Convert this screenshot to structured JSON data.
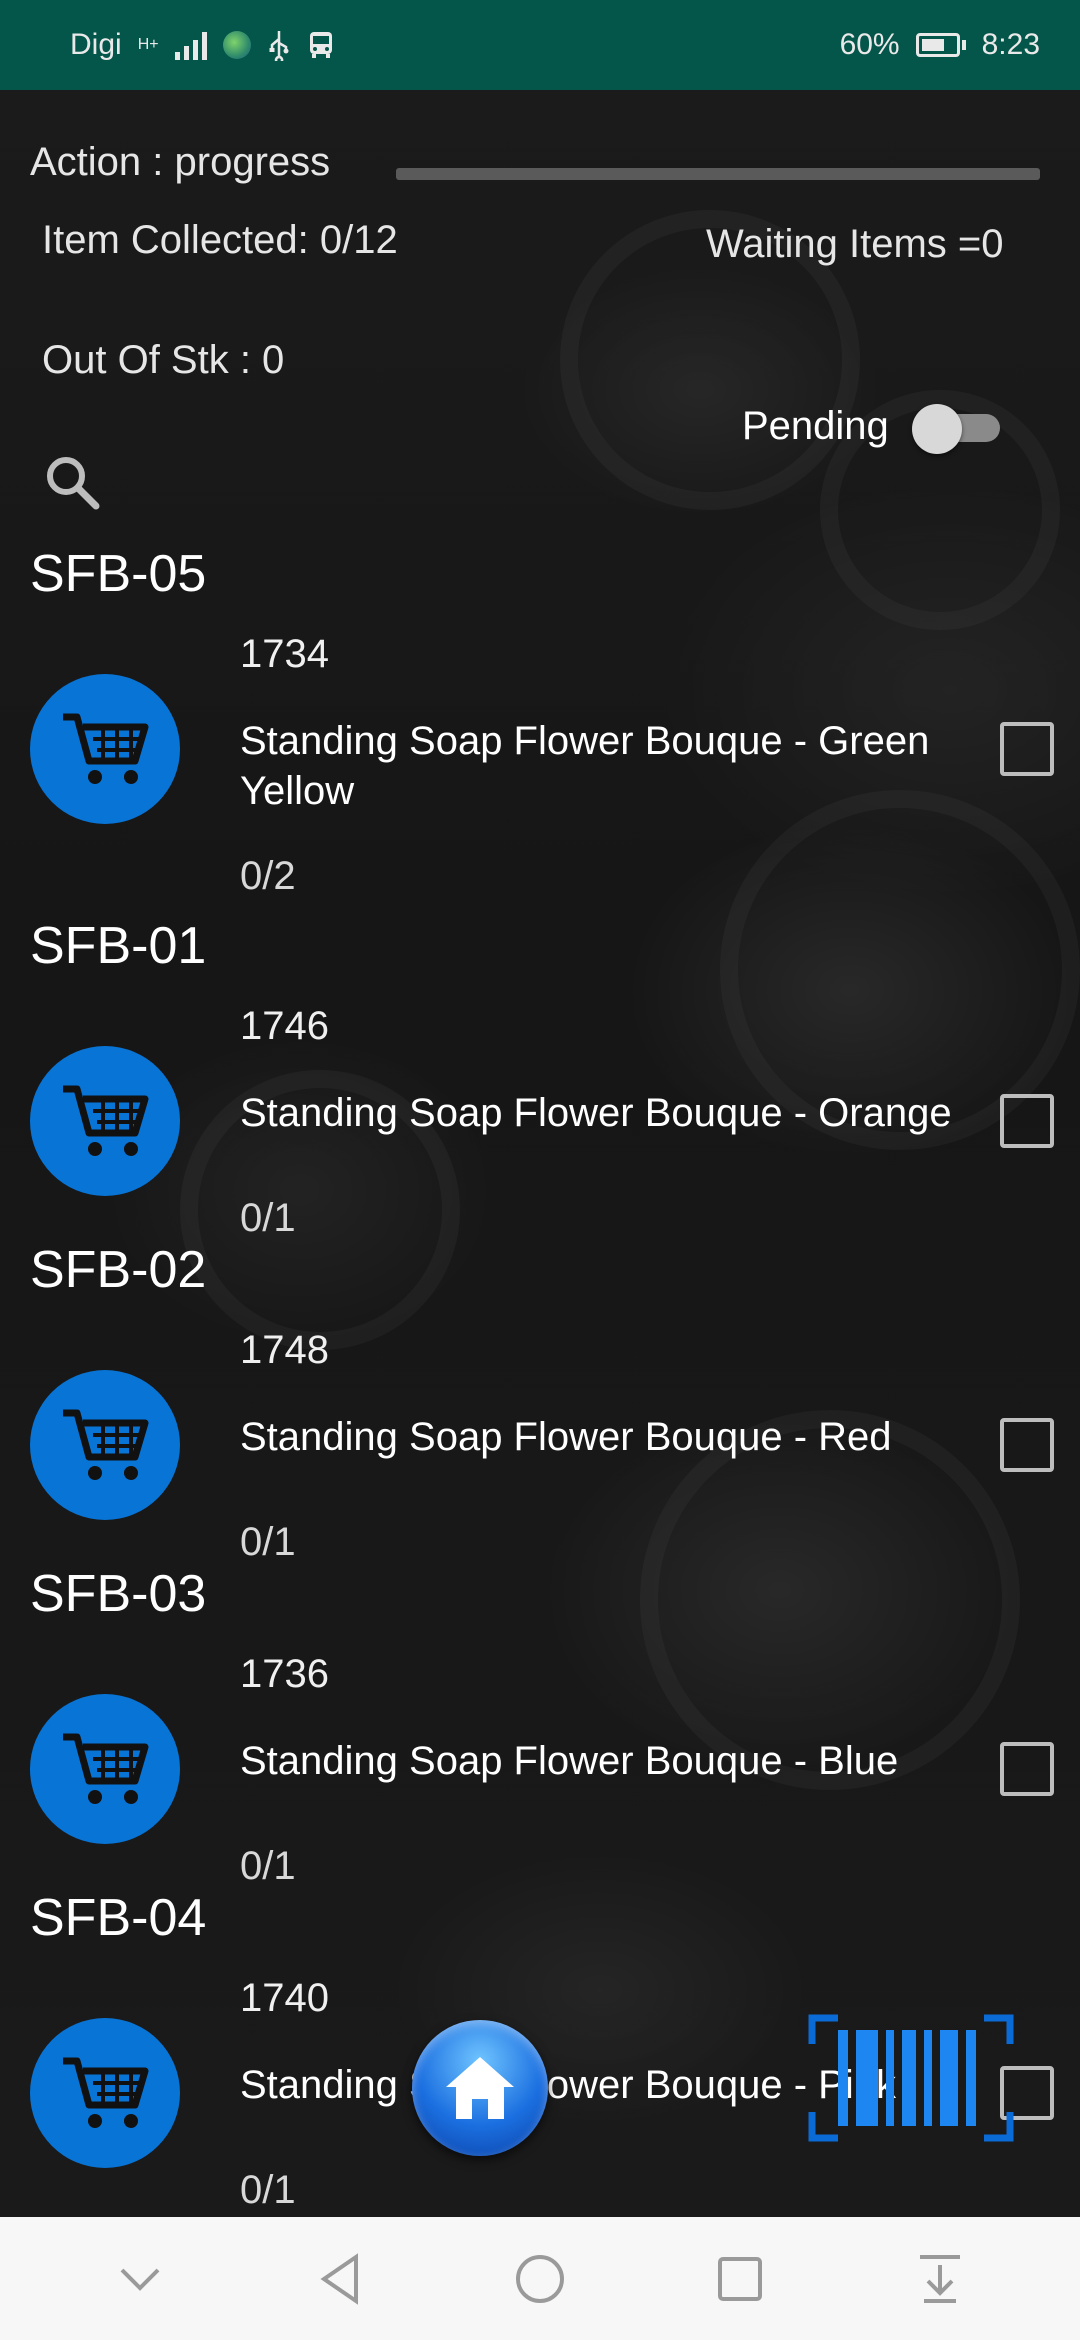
{
  "status_bar": {
    "carrier": "Digi",
    "network": "H+",
    "battery": "60%",
    "time": "8:23"
  },
  "header": {
    "action_text": "Action : progress",
    "progress_fraction": 0,
    "collected_text": "Item Collected: 0/12",
    "waiting_text": "Waiting Items =0",
    "out_of_stock_text": "Out Of Stk : 0",
    "pending_label": "Pending",
    "pending_on": false
  },
  "sections": [
    {
      "title": "SFB-05",
      "code": "1734",
      "name": "Standing Soap Flower Bouque - Green Yellow",
      "qty": "0/2"
    },
    {
      "title": "SFB-01",
      "code": "1746",
      "name": "Standing Soap Flower Bouque - Orange",
      "qty": "0/1"
    },
    {
      "title": "SFB-02",
      "code": "1748",
      "name": "Standing Soap Flower Bouque - Red",
      "qty": "0/1"
    },
    {
      "title": "SFB-03",
      "code": "1736",
      "name": "Standing Soap Flower Bouque - Blue",
      "qty": "0/1"
    },
    {
      "title": "SFB-04",
      "code": "1740",
      "name": "Standing Soap Flower Bouque - Pink",
      "qty": "0/1"
    }
  ],
  "colors": {
    "status_bar_bg": "#05564a",
    "cart_blue": "#0874d6",
    "nav_bg": "#f7f7f7"
  },
  "icons": {
    "search": "search-icon",
    "cart": "shopping-cart-icon",
    "home": "home-icon",
    "barcode": "barcode-scanner-icon"
  },
  "nav": [
    "collapse-icon",
    "back-icon",
    "home-circle-icon",
    "recents-icon",
    "notifications-down-icon"
  ]
}
